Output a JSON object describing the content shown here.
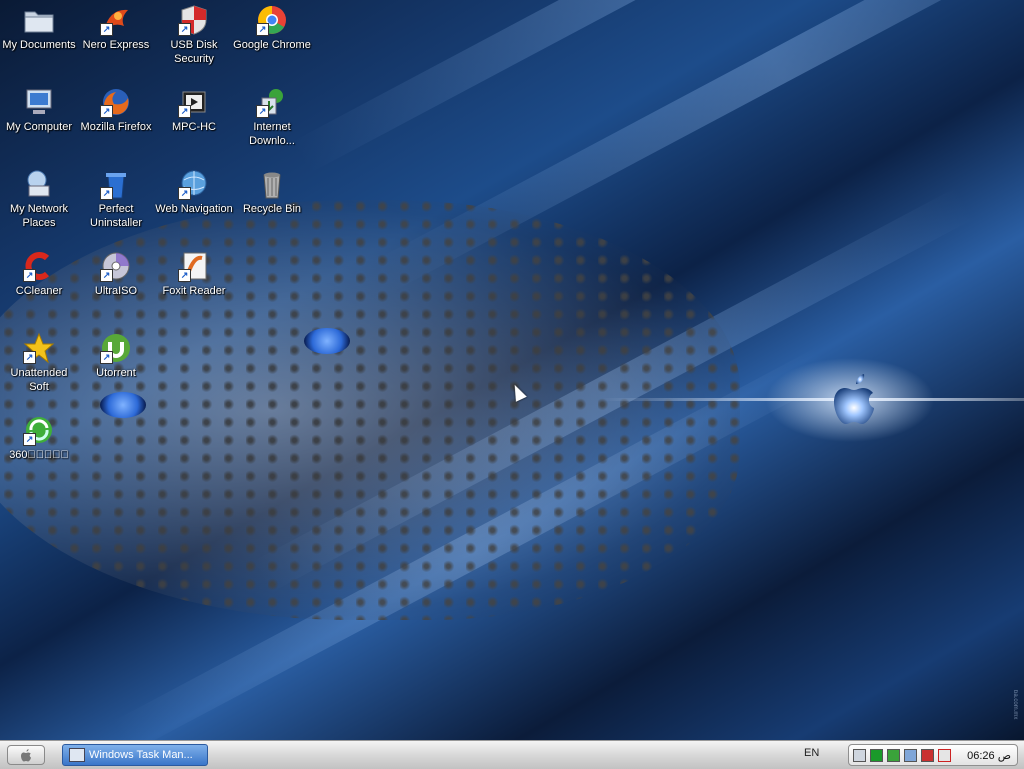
{
  "desktop": {
    "icons": [
      {
        "id": "my-documents",
        "label": "My Documents",
        "icon": "folder-icon",
        "shortcut": false,
        "color": "#c9d4e2"
      },
      {
        "id": "nero-express",
        "label": "Nero Express",
        "icon": "nero-icon",
        "shortcut": true,
        "color": "#e04a1a"
      },
      {
        "id": "usb-disk-security",
        "label": "USB Disk Security",
        "icon": "shield-icon",
        "shortcut": true,
        "color": "#d8d8d8"
      },
      {
        "id": "google-chrome",
        "label": "Google Chrome",
        "icon": "chrome-icon",
        "shortcut": true,
        "color": "#e94235"
      },
      {
        "id": "my-computer",
        "label": "My Computer",
        "icon": "computer-icon",
        "shortcut": false,
        "color": "#cfe0f2"
      },
      {
        "id": "mozilla-firefox",
        "label": "Mozilla Firefox",
        "icon": "firefox-icon",
        "shortcut": true,
        "color": "#e66a1c"
      },
      {
        "id": "mpc-hc",
        "label": "MPC-HC",
        "icon": "film-icon",
        "shortcut": true,
        "color": "#333333"
      },
      {
        "id": "internet-download",
        "label": "Internet Downlo...",
        "icon": "download-icon",
        "shortcut": true,
        "color": "#3aa33a"
      },
      {
        "id": "my-network-places",
        "label": "My Network Places",
        "icon": "network-icon",
        "shortcut": false,
        "color": "#b8d2ee"
      },
      {
        "id": "perfect-uninstaller",
        "label": "Perfect Uninstaller",
        "icon": "trashcan-blue-icon",
        "shortcut": true,
        "color": "#2b6fd1"
      },
      {
        "id": "web-navigation",
        "label": "Web Navigation",
        "icon": "globe-icon",
        "shortcut": true,
        "color": "#5aa0dd"
      },
      {
        "id": "recycle-bin",
        "label": "Recycle Bin",
        "icon": "recycle-bin-icon",
        "shortcut": false,
        "color": "#b0b0b0"
      },
      {
        "id": "ccleaner",
        "label": "CCleaner",
        "icon": "ccleaner-icon",
        "shortcut": true,
        "color": "#d9281c"
      },
      {
        "id": "ultraiso",
        "label": "UltraISO",
        "icon": "disc-icon",
        "shortcut": true,
        "color": "#c6c6d8"
      },
      {
        "id": "foxit-reader",
        "label": "Foxit Reader",
        "icon": "pdf-icon",
        "shortcut": true,
        "color": "#e06a20"
      },
      {
        "id": "unattended-soft",
        "label": "Unattended Soft",
        "icon": "star-icon",
        "shortcut": true,
        "color": "#f2c21a"
      },
      {
        "id": "utorrent",
        "label": "Utorrent",
        "icon": "utorrent-icon",
        "shortcut": true,
        "color": "#58a838"
      },
      {
        "id": "360",
        "label": "360\u0000\u0000\u0000\u0000\u0000",
        "icon": "360-icon",
        "shortcut": true,
        "color": "#3fae3a"
      }
    ]
  },
  "taskbar": {
    "start_icon": "apple-icon",
    "task_label": "Windows Task Man...",
    "language": "EN",
    "clock": "ص 06:26",
    "tray_icons": [
      "network-cable-icon",
      "green-square-icon",
      "download-tray-icon",
      "monitor-tray-icon",
      "antivirus-tray-icon",
      "shield-tray-icon"
    ]
  },
  "colors": {
    "accent": "#3a76c9",
    "wallpaper_dark": "#0a1a35",
    "wallpaper_light": "#2a5ea3"
  }
}
